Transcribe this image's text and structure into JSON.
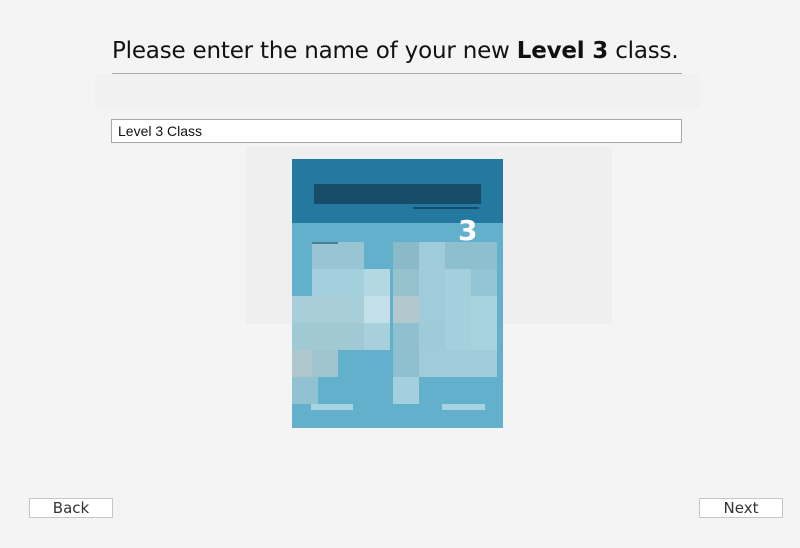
{
  "header": {
    "prompt_prefix": "Please enter the name of your new ",
    "prompt_emphasis": "Level 3",
    "prompt_suffix": " class."
  },
  "class_name_input": {
    "value": "Level 3 Class"
  },
  "cover_preview": {
    "level_number": "3",
    "colors": {
      "header": "#2479a1",
      "body": "#62b0cb",
      "title_bar": "#174d68"
    }
  },
  "footer": {
    "back_label": "Back",
    "next_label": "Next"
  }
}
